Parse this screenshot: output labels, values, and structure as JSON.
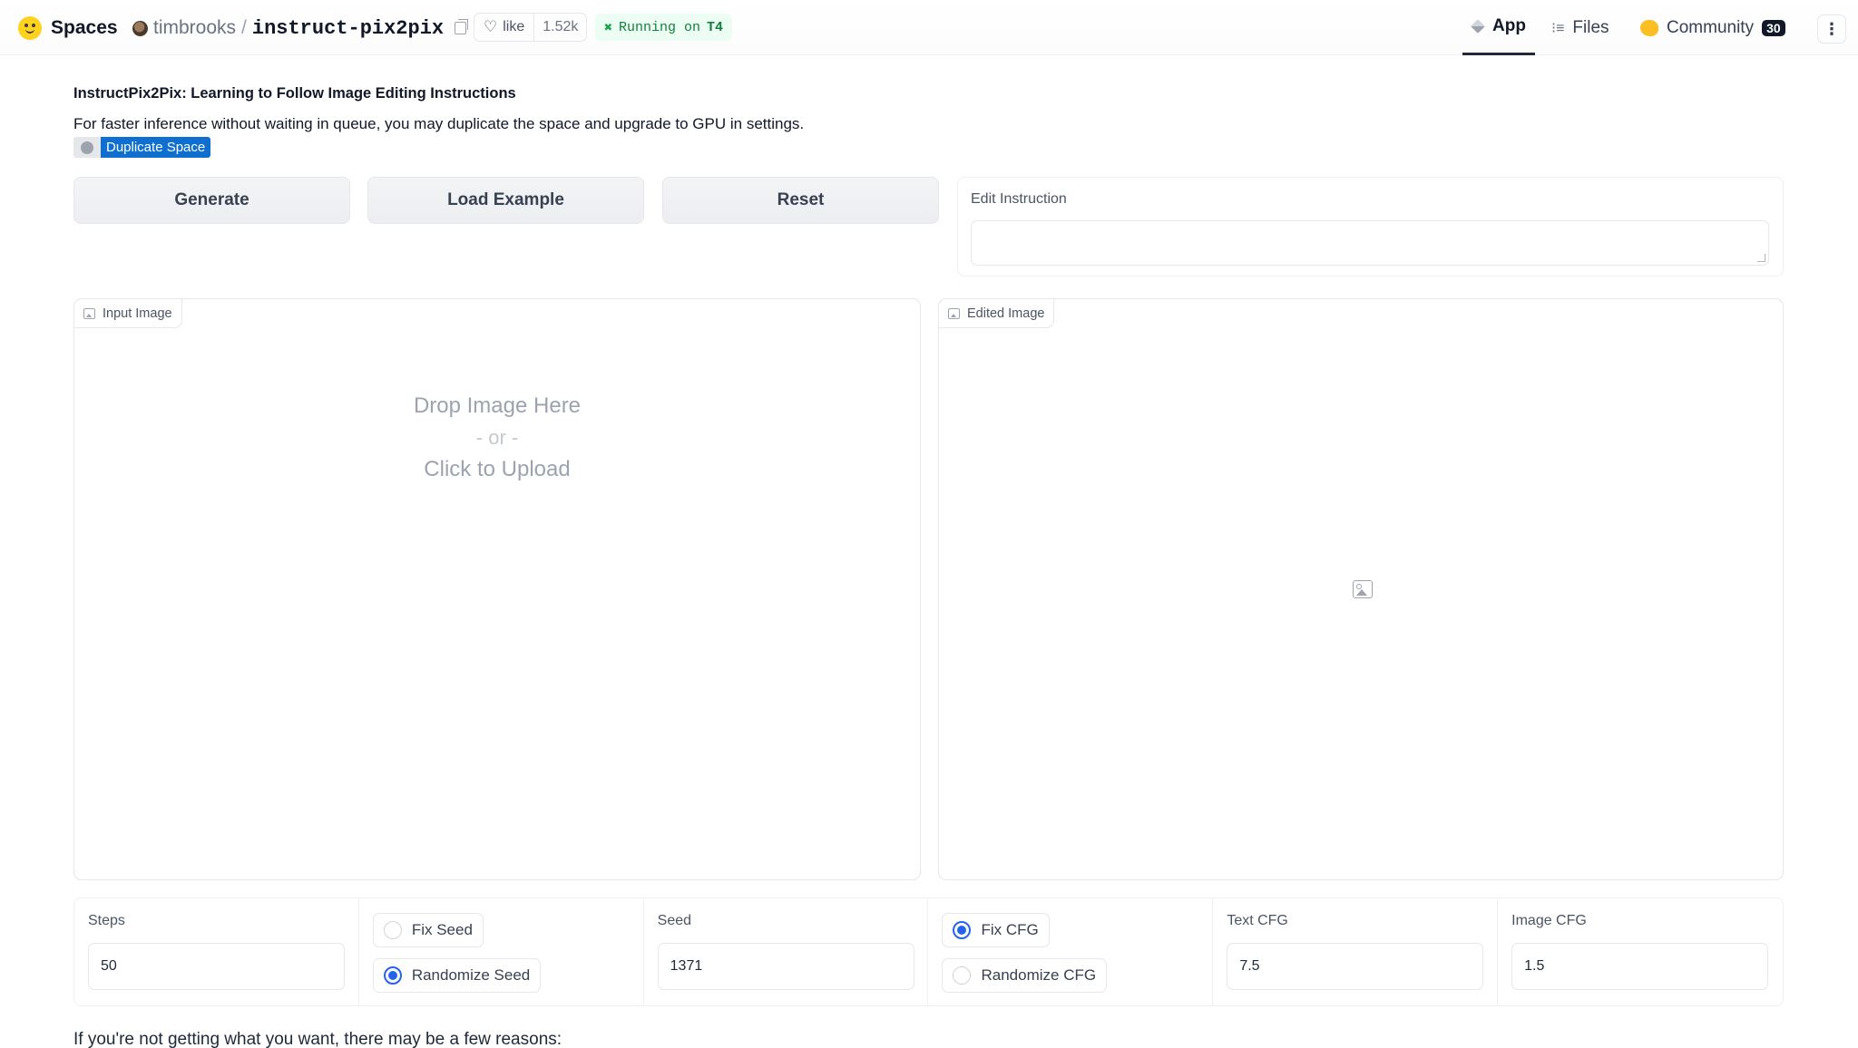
{
  "header": {
    "brand": "Spaces",
    "owner": "timbrooks",
    "separator": "/",
    "repo_name": "instruct-pix2pix",
    "like_label": "like",
    "like_count": "1.52k",
    "running_prefix": "Running on",
    "running_hardware": "T4",
    "nav": {
      "app": "App",
      "files": "Files",
      "community": "Community",
      "community_count": "30"
    }
  },
  "intro": {
    "title": "InstructPix2Pix: Learning to Follow Image Editing Instructions",
    "subtitle": "For faster inference without waiting in queue, you may duplicate the space and upgrade to GPU in settings.",
    "duplicate_label": "Duplicate Space"
  },
  "buttons": {
    "generate": "Generate",
    "load_example": "Load Example",
    "reset": "Reset"
  },
  "edit_instruction": {
    "label": "Edit Instruction",
    "value": ""
  },
  "input_image": {
    "label": "Input Image",
    "drop_text": "Drop Image Here",
    "or_text": "- or -",
    "click_text": "Click to Upload"
  },
  "edited_image": {
    "label": "Edited Image"
  },
  "controls": {
    "steps": {
      "label": "Steps",
      "value": "50"
    },
    "seed_mode": {
      "options": [
        "Fix Seed",
        "Randomize Seed"
      ],
      "selected": "Randomize Seed"
    },
    "seed": {
      "label": "Seed",
      "value": "1371"
    },
    "cfg_mode": {
      "options": [
        "Fix CFG",
        "Randomize CFG"
      ],
      "selected": "Fix CFG"
    },
    "text_cfg": {
      "label": "Text CFG",
      "value": "7.5"
    },
    "image_cfg": {
      "label": "Image CFG",
      "value": "1.5"
    }
  },
  "footer": {
    "text": "If you're not getting what you want, there may be a few reasons:"
  },
  "colors": {
    "accent": "#2563eb",
    "duplicate_button": "#0f6fd1",
    "running_text": "#15803d"
  }
}
